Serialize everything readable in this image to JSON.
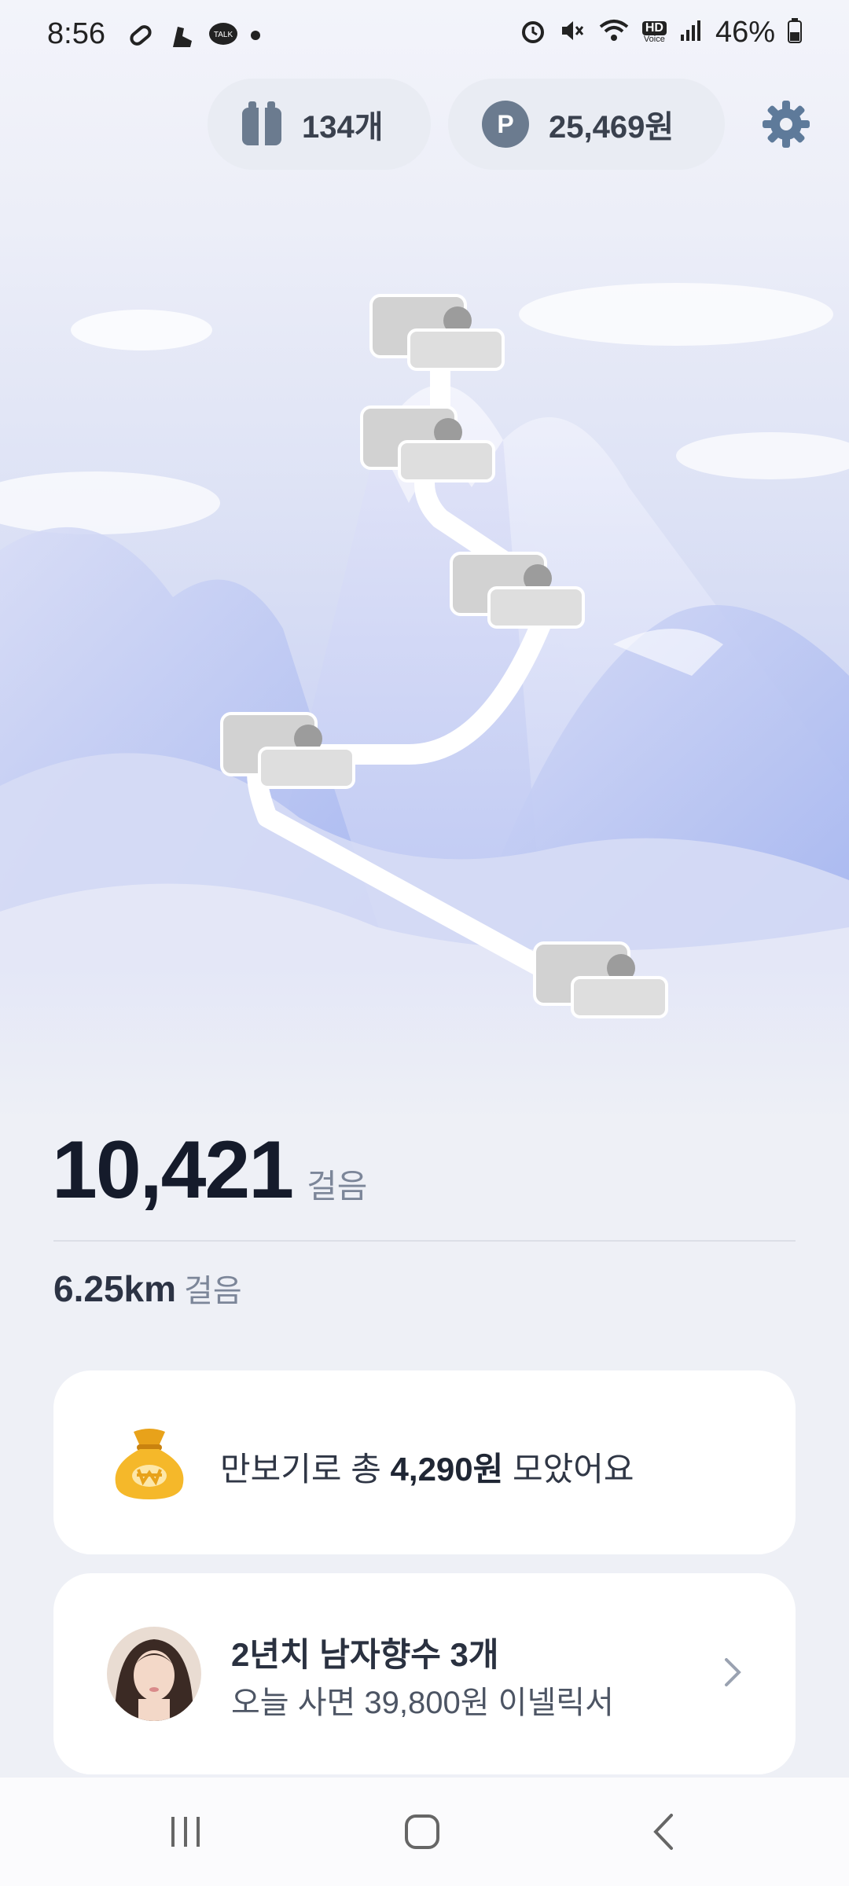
{
  "status": {
    "time": "8:56",
    "battery": "46%",
    "hd_label": "HD",
    "voice_label": "Voice",
    "talk_label": "TALK"
  },
  "header": {
    "gift_count": "134개",
    "points": "25,469원",
    "points_symbol": "P"
  },
  "map": {
    "stops": 5
  },
  "steps": {
    "count": "10,421",
    "unit": "걸음",
    "distance": "6.25km",
    "distance_unit": "걸음"
  },
  "savings": {
    "prefix": "만보기로 총 ",
    "amount": "4,290원",
    "suffix": " 모았어요"
  },
  "ad": {
    "title": "2년치 남자향수 3개",
    "subtitle": "오늘 사면 39,800원 이넬릭서"
  },
  "colors": {
    "accent": "#5e7a9a",
    "text_dark": "#151b2b",
    "muted": "#7c8699"
  }
}
